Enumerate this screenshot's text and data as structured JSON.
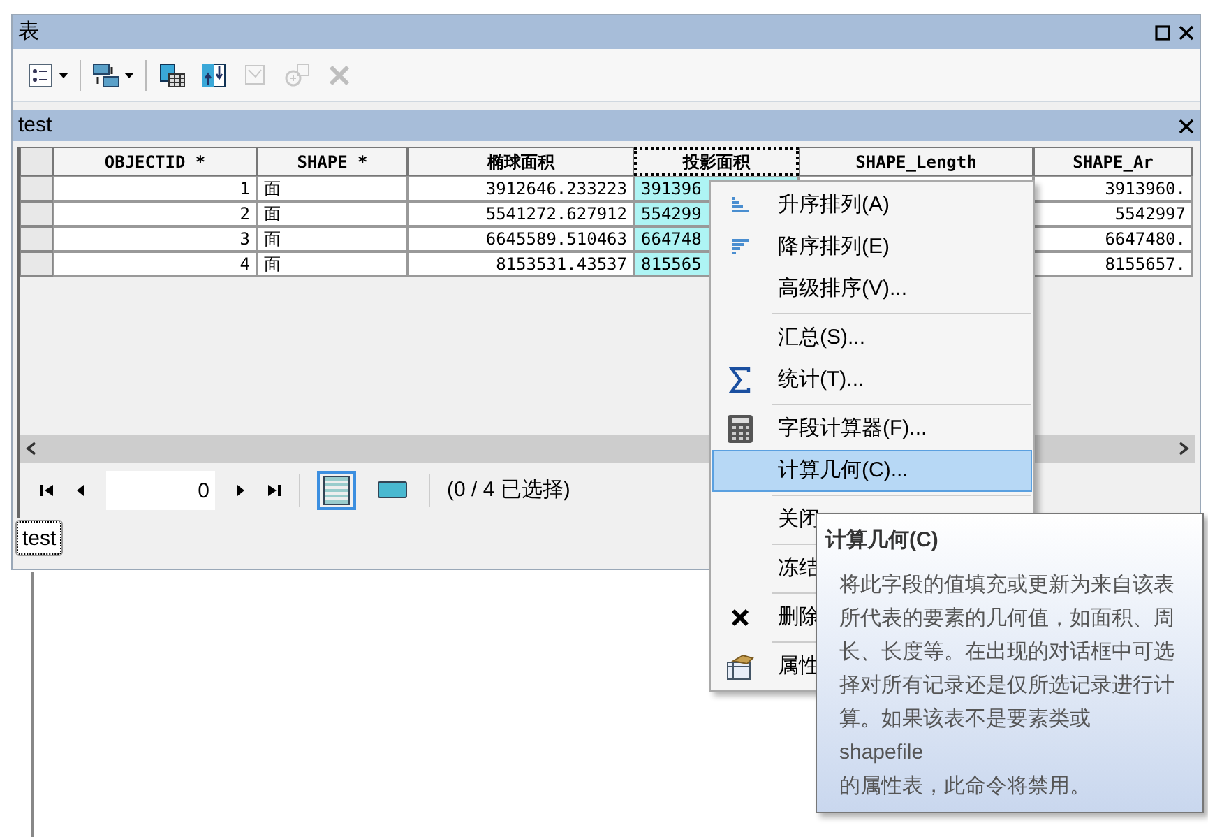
{
  "window": {
    "title": "表"
  },
  "toolbar": {
    "buttons": [
      {
        "kind": "options",
        "disabled": false
      },
      {
        "kind": "relate",
        "disabled": false
      },
      {
        "kind": "select-by",
        "disabled": false
      },
      {
        "kind": "switch",
        "disabled": false
      },
      {
        "kind": "clear",
        "disabled": true
      },
      {
        "kind": "zoom",
        "disabled": true
      },
      {
        "kind": "delete",
        "disabled": true
      }
    ]
  },
  "table_title": "test",
  "table": {
    "columns": [
      {
        "label": "OBJECTID *",
        "selected": false
      },
      {
        "label": "SHAPE *",
        "selected": false
      },
      {
        "label": "椭球面积",
        "selected": false
      },
      {
        "label": "投影面积",
        "selected": true
      },
      {
        "label": "SHAPE_Length",
        "selected": false
      },
      {
        "label": "SHAPE_Ar",
        "selected": false
      }
    ],
    "rows": [
      {
        "cells": [
          "1",
          "面",
          "3912646.233223",
          "391396",
          null,
          "3913960."
        ]
      },
      {
        "cells": [
          "2",
          "面",
          "5541272.627912",
          "554299",
          null,
          "5542997"
        ]
      },
      {
        "cells": [
          "3",
          "面",
          "6645589.510463",
          "664748",
          null,
          "6647480."
        ]
      },
      {
        "cells": [
          "4",
          "面",
          "8153531.43537",
          "815565",
          null,
          "8155657."
        ]
      }
    ]
  },
  "navigator": {
    "record": "0",
    "views": [
      {
        "kind": "all",
        "selected": true
      },
      {
        "kind": "selected",
        "selected": false
      }
    ],
    "selection": "(0 / 4 已选择)"
  },
  "tabs": [
    {
      "label": "test",
      "selected": true
    }
  ],
  "context_menu": {
    "items": [
      {
        "kind": "item",
        "label": "升序排列(A)",
        "selected": false
      },
      {
        "kind": "item",
        "label": "降序排列(E)",
        "selected": false
      },
      {
        "kind": "item",
        "label": "高级排序(V)...",
        "selected": false
      },
      {
        "kind": "separator"
      },
      {
        "kind": "item",
        "label": "汇总(S)...",
        "selected": false
      },
      {
        "kind": "item",
        "label": "统计(T)...",
        "selected": false
      },
      {
        "kind": "separator"
      },
      {
        "kind": "item",
        "label": "字段计算器(F)...",
        "selected": false
      },
      {
        "kind": "item",
        "label": "计算几何(C)...",
        "selected": true
      },
      {
        "kind": "separator"
      },
      {
        "kind": "item",
        "label": "关闭",
        "selected": false
      },
      {
        "kind": "separator"
      },
      {
        "kind": "item",
        "label": "冻结",
        "selected": false
      },
      {
        "kind": "separator"
      },
      {
        "kind": "item",
        "label": "删除",
        "selected": false
      },
      {
        "kind": "separator"
      },
      {
        "kind": "item",
        "label": "属性",
        "selected": false
      }
    ]
  },
  "tooltip": {
    "title": "计算几何(C)",
    "body": "将此字段的值填充或更新为来自该表所代表的要素的几何值，如面积、周长、长度等。在出现的对话框中可选择对所有记录还是仅所选记录进行计算。如果该表不是要素类或 shapefile\n的属性表，此命令将禁用。"
  }
}
